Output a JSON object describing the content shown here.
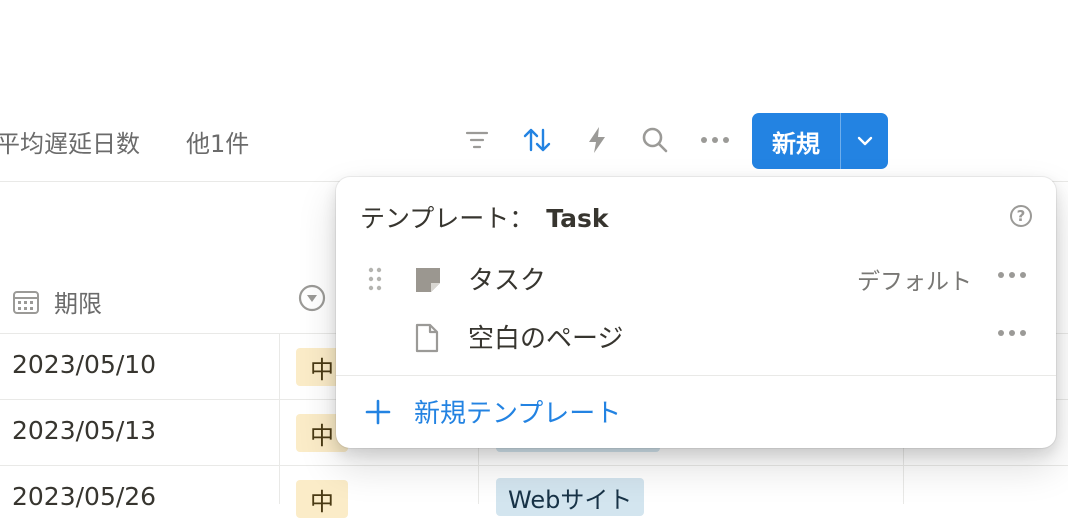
{
  "toolbar": {
    "view_tab_1": "平均遅延日数",
    "view_tab_2": "他1件",
    "icons": [
      "filter-icon",
      "sort-icon",
      "automation-icon",
      "search-icon",
      "more-icon"
    ],
    "new_label": "新規",
    "accent_color": "#2383e2"
  },
  "table": {
    "columns": [
      {
        "label": "期限",
        "icon": "calendar-icon"
      },
      {
        "label": "",
        "icon": "select-icon"
      }
    ],
    "rows": [
      {
        "date": "2023/05/10",
        "priority": "中",
        "category": ""
      },
      {
        "date": "2023/05/13",
        "priority": "中",
        "category": ""
      },
      {
        "date": "2023/05/26",
        "priority": "中",
        "category": "Webサイト"
      }
    ]
  },
  "template_menu": {
    "title_prefix": "テンプレート：",
    "title_name": "Task",
    "items": [
      {
        "name": "タスク",
        "badge": "デフォルト",
        "icon": "template-page-icon"
      },
      {
        "name": "空白のページ",
        "badge": "",
        "icon": "blank-page-icon"
      }
    ],
    "new_template_label": "新規テンプレート"
  }
}
